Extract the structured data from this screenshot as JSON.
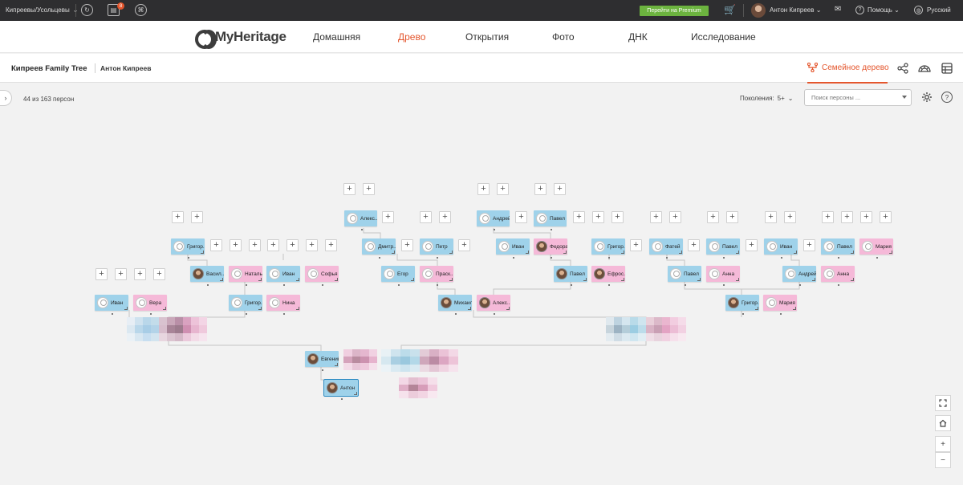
{
  "topbar": {
    "site_label": "Кипреевы/Усольцевы",
    "notifications_count": "8",
    "premium_label": "Перейти на Premium",
    "user_name": "Антон Кипреев",
    "help_label": "Помощь",
    "language_label": "Русский"
  },
  "nav": {
    "logo": "MyHeritage",
    "items": [
      "Домашняя",
      "Древо",
      "Открытия",
      "Фото",
      "ДНК",
      "Исследование"
    ],
    "active": "Древо"
  },
  "subheader": {
    "tree_title": "Кипреев Family Tree",
    "owner": "Антон Кипреев",
    "view_label": "Семейное дерево"
  },
  "toolbar": {
    "count": "44 из 163 персон",
    "generations_label": "Поколения:",
    "generations_value": "5+",
    "search_placeholder": "Поиск персоны ..."
  },
  "people": [
    {
      "id": "p1",
      "name": "Алекс...",
      "sex": "m"
    },
    {
      "id": "p2",
      "name": "Андрей",
      "sex": "m"
    },
    {
      "id": "p3",
      "name": "Павел",
      "sex": "m"
    },
    {
      "id": "p4",
      "name": "Григор...",
      "sex": "m"
    },
    {
      "id": "p5",
      "name": "Дмитр...",
      "sex": "m"
    },
    {
      "id": "p6",
      "name": "Петр",
      "sex": "m"
    },
    {
      "id": "p7",
      "name": "Иван",
      "sex": "m"
    },
    {
      "id": "p8",
      "name": "Федора",
      "sex": "f"
    },
    {
      "id": "p9",
      "name": "Григор...",
      "sex": "m"
    },
    {
      "id": "p10",
      "name": "Фатей",
      "sex": "m"
    },
    {
      "id": "p11",
      "name": "Павел",
      "sex": "m"
    },
    {
      "id": "p12",
      "name": "Иван",
      "sex": "m"
    },
    {
      "id": "p13",
      "name": "Павел",
      "sex": "m"
    },
    {
      "id": "p14",
      "name": "Мария",
      "sex": "f"
    },
    {
      "id": "p15",
      "name": "Васил...",
      "sex": "m"
    },
    {
      "id": "p16",
      "name": "Наталья",
      "sex": "f"
    },
    {
      "id": "p17",
      "name": "Иван",
      "sex": "m"
    },
    {
      "id": "p18",
      "name": "Софья",
      "sex": "f"
    },
    {
      "id": "p19",
      "name": "Егор",
      "sex": "m"
    },
    {
      "id": "p20",
      "name": "Праск...",
      "sex": "f"
    },
    {
      "id": "p21",
      "name": "Павел",
      "sex": "m"
    },
    {
      "id": "p22",
      "name": "Ефрос...",
      "sex": "f"
    },
    {
      "id": "p23",
      "name": "Павел",
      "sex": "m"
    },
    {
      "id": "p24",
      "name": "Анна",
      "sex": "f"
    },
    {
      "id": "p25",
      "name": "Андрей",
      "sex": "m"
    },
    {
      "id": "p26",
      "name": "Анна",
      "sex": "f"
    },
    {
      "id": "p27",
      "name": "Иван",
      "sex": "m"
    },
    {
      "id": "p28",
      "name": "Вера",
      "sex": "f"
    },
    {
      "id": "p29",
      "name": "Григор...",
      "sex": "m"
    },
    {
      "id": "p30",
      "name": "Нина",
      "sex": "f"
    },
    {
      "id": "p31",
      "name": "Михаил",
      "sex": "m"
    },
    {
      "id": "p32",
      "name": "Алекс...",
      "sex": "f"
    },
    {
      "id": "p33",
      "name": "Григор...",
      "sex": "m"
    },
    {
      "id": "p34",
      "name": "Мария",
      "sex": "f"
    },
    {
      "id": "p35",
      "name": "Евгений",
      "sex": "m"
    },
    {
      "id": "p36",
      "name": "Антон",
      "sex": "m"
    }
  ],
  "colors": {
    "accent": "#e4562d",
    "male": "#9fd2ea",
    "female": "#f5b9d8",
    "premium": "#6cb33f"
  },
  "icons": [
    "sync-icon",
    "notifications-icon",
    "dna-icon",
    "cart-icon",
    "mail-icon",
    "help-icon",
    "globe-icon",
    "family-tree-icon",
    "share-icon",
    "fan-chart-icon",
    "table-icon",
    "settings-icon",
    "fullscreen-icon",
    "home-icon",
    "zoom-in-icon",
    "zoom-out-icon"
  ]
}
